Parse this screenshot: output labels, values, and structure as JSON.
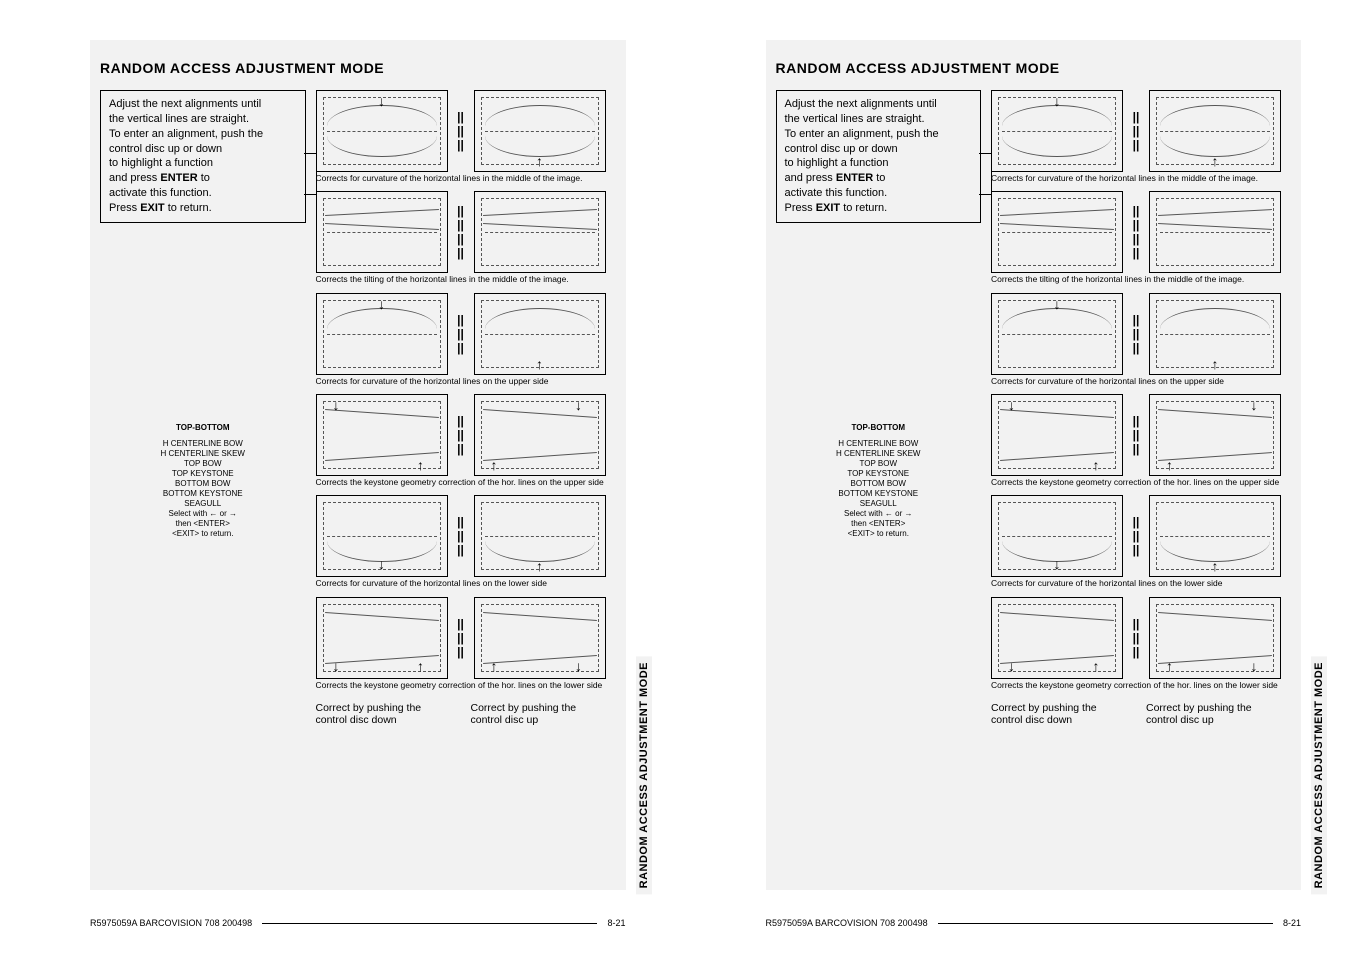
{
  "header": "RANDOM ACCESS ADJUSTMENT MODE",
  "instruction": {
    "line1": "Adjust the next alignments until",
    "line2": "the vertical lines are straight.",
    "line3": "To enter an alignment, push the",
    "line4": "control disc up or down",
    "line5": "to highlight a function",
    "line6a": "and press ",
    "line6b": "ENTER",
    "line6c": " to",
    "line7": "activate this function.",
    "line8a": "Press ",
    "line8b": "EXIT",
    "line8c": " to return."
  },
  "menu": {
    "title": "TOP-BOTTOM",
    "items": [
      "H CENTERLINE BOW",
      "H CENTERLINE SKEW",
      "TOP BOW",
      "TOP KEYSTONE",
      "BOTTOM BOW",
      "BOTTOM KEYSTONE",
      "SEAGULL"
    ],
    "hint1": "Select with  ←  or  →",
    "hint2": "then  <ENTER>",
    "hint3": "<EXIT>  to  return."
  },
  "captions": {
    "c1": "Corrects for curvature of the horizontal lines in the middle of the image.",
    "c2": "Corrects the tilting of the horizontal lines in the middle of the image.",
    "c3": "Corrects for curvature of the horizontal lines on the upper side",
    "c4": "Corrects the keystone geometry correction of the hor. lines on the upper side",
    "c5": "Corrects for curvature of the horizontal lines on the lower side",
    "c6": "Corrects the keystone geometry correction of the hor. lines on the lower side"
  },
  "bottom_notes": {
    "left": "Correct by pushing the control disc down",
    "right": "Correct by pushing the control disc up"
  },
  "side_label": "RANDOM ACCESS ADJUSTMENT MODE",
  "footer": {
    "doc": "R5975059A BARCOVISION 708 200498",
    "page": "8-21"
  },
  "sep_glyph": "||"
}
